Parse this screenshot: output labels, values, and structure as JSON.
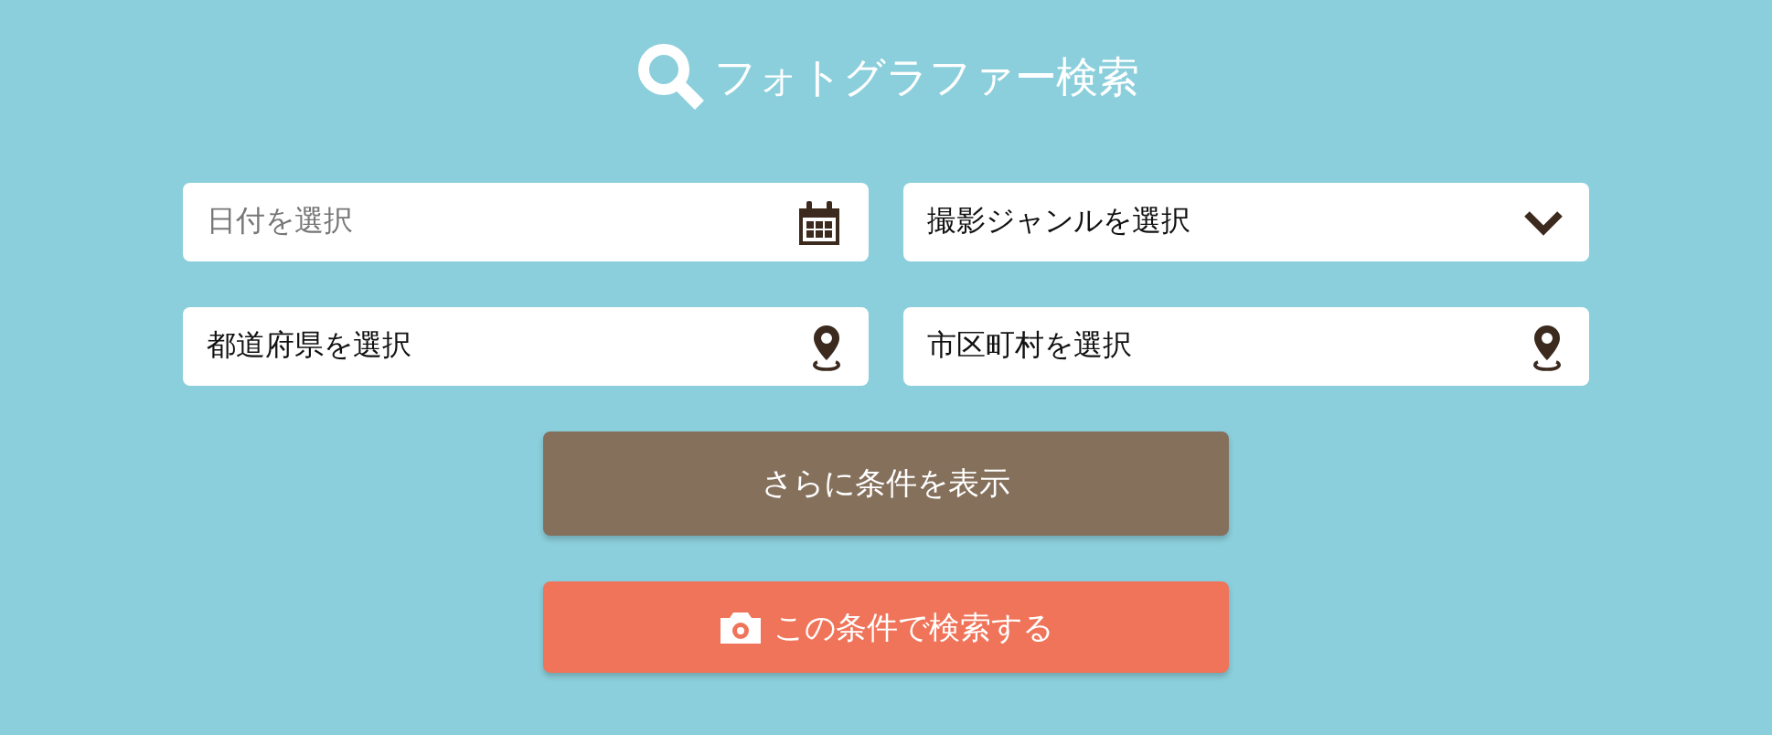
{
  "title": "フォトグラファー検索",
  "fields": [
    {
      "kind": "date",
      "placeholder": "日付を選択"
    },
    {
      "kind": "select",
      "value": "撮影ジャンルを選択"
    },
    {
      "kind": "location",
      "value": "都道府県を選択"
    },
    {
      "kind": "location",
      "value": "市区町村を選択"
    }
  ],
  "buttons": [
    {
      "kind": "more",
      "label": "さらに条件を表示"
    },
    {
      "kind": "search",
      "label": "この条件で検索する"
    }
  ]
}
